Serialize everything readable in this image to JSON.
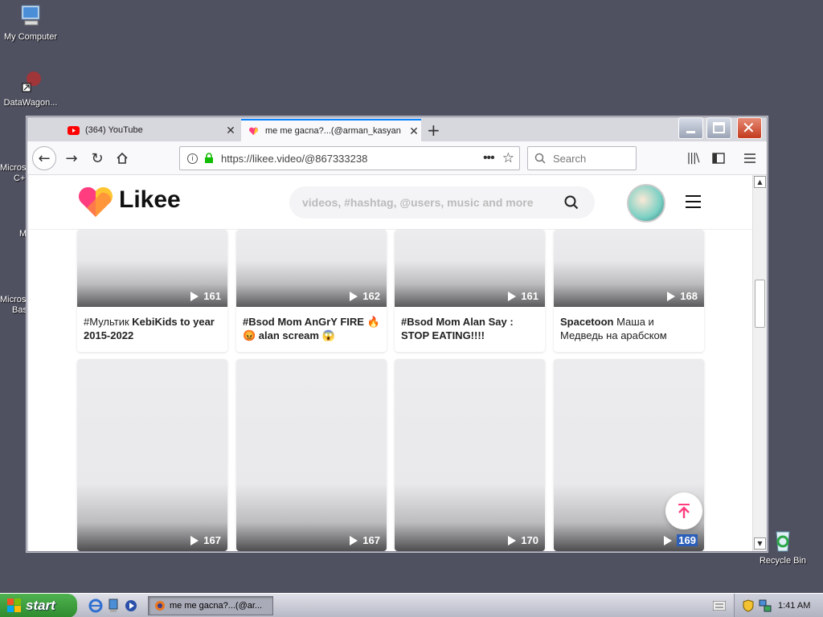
{
  "desktop": {
    "icons": [
      {
        "label": "My Computer"
      },
      {
        "label": "DataWagon..."
      },
      {
        "label": "Recycle Bin"
      }
    ],
    "partial_labels": [
      "Micros",
      "C+",
      "M",
      "Micros",
      "Bas"
    ]
  },
  "browser": {
    "tabs": [
      {
        "title": "(364) YouTube"
      },
      {
        "title": "me me gacna?...(@arman_kasyan"
      }
    ],
    "url": "https://likee.video/@867333238",
    "search_placeholder": "Search"
  },
  "likee": {
    "logo": "Likee",
    "search_placeholder": "videos, #hashtag, @users, music and more",
    "row1": [
      {
        "views": "161",
        "title_parts": [
          {
            "text": "#Мультик ",
            "bold": false
          },
          {
            "text": "KebiKids to year 2015-2022",
            "bold": true
          }
        ]
      },
      {
        "views": "162",
        "title_parts": [
          {
            "text": "#Bsod Mom AnGrY FIRE 🔥😡 alan scream 😱",
            "bold": true
          }
        ]
      },
      {
        "views": "161",
        "title_parts": [
          {
            "text": "#Bsod Mom Alan Say : STOP EATING!!!!",
            "bold": true
          }
        ]
      },
      {
        "views": "168",
        "title_parts": [
          {
            "text": "Spacetoon ",
            "bold": true
          },
          {
            "text": "Маша и Медведь на арабском",
            "bold": false
          }
        ]
      }
    ],
    "row2": [
      {
        "views": "167"
      },
      {
        "views": "167"
      },
      {
        "views": "170"
      },
      {
        "views": "169"
      }
    ]
  },
  "taskbar": {
    "start_label": "start",
    "task_label": "me me gacna?...(@ar...",
    "clock": "1:41 AM"
  },
  "colors": {
    "likee_pink": "#ff3d7f",
    "likee_yellow": "#ffc531",
    "active_tab": "#0a84ff"
  }
}
